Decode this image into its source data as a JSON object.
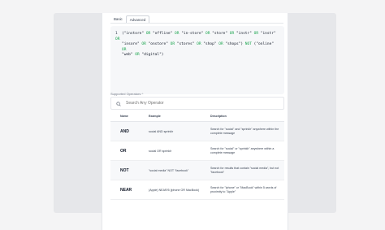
{
  "tabs": [
    {
      "label": "Basic",
      "active": false
    },
    {
      "label": "Advanced",
      "active": true
    }
  ],
  "editor": {
    "line_number": "1",
    "segments_line1": [
      {
        "t": "(",
        "c": "st"
      },
      {
        "t": "\"instore\"",
        "c": "st"
      },
      {
        "t": " OR ",
        "c": "kw"
      },
      {
        "t": "\"offline\"",
        "c": "st"
      },
      {
        "t": " OR ",
        "c": "kw"
      },
      {
        "t": "\"in-store\"",
        "c": "st"
      },
      {
        "t": " OR ",
        "c": "kw"
      },
      {
        "t": "\"store\"",
        "c": "st"
      },
      {
        "t": " OR ",
        "c": "kw"
      },
      {
        "t": "\"instr\"",
        "c": "st"
      },
      {
        "t": " OR ",
        "c": "kw"
      },
      {
        "t": "\"instr\"",
        "c": "st"
      },
      {
        "t": " OR",
        "c": "kw"
      }
    ],
    "segments_line2": [
      {
        "t": "\"insore\"",
        "c": "st"
      },
      {
        "t": " OR ",
        "c": "kw"
      },
      {
        "t": "\"onstore\"",
        "c": "st"
      },
      {
        "t": " OR ",
        "c": "kw"
      },
      {
        "t": "\"stores\"",
        "c": "st"
      },
      {
        "t": " OR ",
        "c": "kw"
      },
      {
        "t": "\"shop\"",
        "c": "st"
      },
      {
        "t": " OR ",
        "c": "kw"
      },
      {
        "t": "\"shops\")",
        "c": "st"
      },
      {
        "t": " NOT ",
        "c": "kw"
      },
      {
        "t": "(\"online\"",
        "c": "st"
      },
      {
        "t": " OR",
        "c": "kw"
      }
    ],
    "segments_line3": [
      {
        "t": "\"web\"",
        "c": "st"
      },
      {
        "t": " OR ",
        "c": "kw"
      },
      {
        "t": "\"digital\")",
        "c": "st"
      }
    ]
  },
  "supported_label": "Supported Operators",
  "search": {
    "placeholder": "Search Any Operator"
  },
  "table": {
    "headers": [
      "Name",
      "Example",
      "Description"
    ],
    "rows": [
      {
        "name": "AND",
        "example": "social AND sprinklr",
        "description": "Search for \"social\" and \"sprinklr\" anywhere within the complete message"
      },
      {
        "name": "OR",
        "example": "social OR sprinklr",
        "description": "Search for \"social\" or \"sprinklr\" anywhere within a complete message"
      },
      {
        "name": "NOT",
        "example": "\"social media\" NOT \"facebook\"",
        "description": "Search for results that contain \"social media\", but not \"facebook\""
      },
      {
        "name": "NEAR",
        "example": "(Apple) NEAR/5 (iphone OR MacBook)",
        "description": "Search for \"iphone\" or \"MacBook\" within 5 words of proximity to \"Apple\""
      }
    ]
  }
}
